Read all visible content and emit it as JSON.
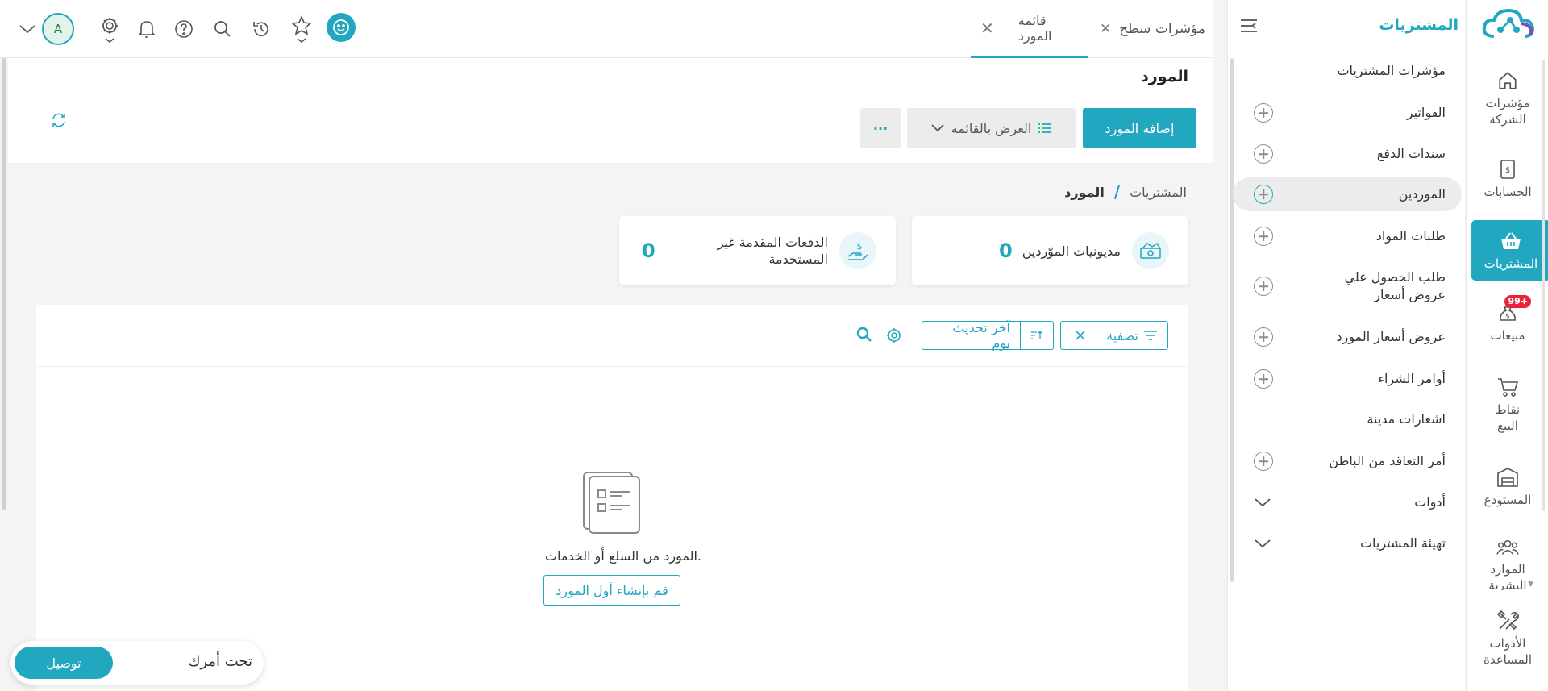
{
  "colors": {
    "accent": "#22a7c0",
    "badge": "#e8233a"
  },
  "rail": {
    "items": [
      {
        "label": "مؤشرات الشركة",
        "icon": "home-icon"
      },
      {
        "label": "الحسابات",
        "icon": "invoice-dollar-icon"
      },
      {
        "label": "المشتريات",
        "icon": "basket-icon",
        "active": true
      },
      {
        "label": "مبيعات",
        "icon": "money-bag-icon",
        "badge": "99+"
      },
      {
        "label": "نقاط البيع",
        "icon": "cart-icon"
      },
      {
        "label": "المستودع",
        "icon": "warehouse-icon"
      },
      {
        "label": "الموارد البشرية",
        "icon": "people-icon"
      },
      {
        "label": "الأدوات المساعدة",
        "icon": "tools-icon"
      }
    ]
  },
  "side": {
    "title": "المشتريات",
    "items": [
      {
        "label": "مؤشرات المشتريات",
        "plus": false
      },
      {
        "label": "الفواتير",
        "plus": true
      },
      {
        "label": "سندات الدفع",
        "plus": true
      },
      {
        "label": "الموردين",
        "plus": true,
        "active": true
      },
      {
        "label": "طلبات المواد",
        "plus": true
      },
      {
        "label": "طلب الحصول علي عروض أسعار",
        "plus": true
      },
      {
        "label": "عروض أسعار المورد",
        "plus": true
      },
      {
        "label": "أوامر الشراء",
        "plus": true
      },
      {
        "label": "اشعارات مدينة",
        "plus": false
      },
      {
        "label": "أمر التعاقد من الباطن",
        "plus": true
      },
      {
        "label": "أدوات",
        "chevron": true
      },
      {
        "label": "تهيئة المشتريات",
        "chevron": true
      }
    ]
  },
  "topbar": {
    "tabs": [
      {
        "label": "مؤشرات سطح"
      },
      {
        "label": "قائمة المورد",
        "active": true
      }
    ],
    "avatar_initial": "A"
  },
  "page": {
    "title": "المورد",
    "add_button": "إضافة المورد",
    "view_button": "العرض بالقائمة",
    "more_button": "···",
    "breadcrumb": {
      "parent": "المشتريات",
      "separator": "/",
      "current": "المورد"
    },
    "cards": [
      {
        "label": "مديونيات الموّردين",
        "value": "0",
        "icon": "outstanding-icon"
      },
      {
        "label": "الدفعات المقدمة غير المستخدمة",
        "value": "0",
        "icon": "hand-money-icon"
      }
    ],
    "filter_chip": "تصفية",
    "sort_chip": "آخر تحديث يوم",
    "empty_text": "المورد من السلع أو الخدمات.",
    "empty_button": "قم بإنشاء أول المورد"
  },
  "bottom": {
    "label": "تحت أمرك",
    "button": "توصيل"
  }
}
